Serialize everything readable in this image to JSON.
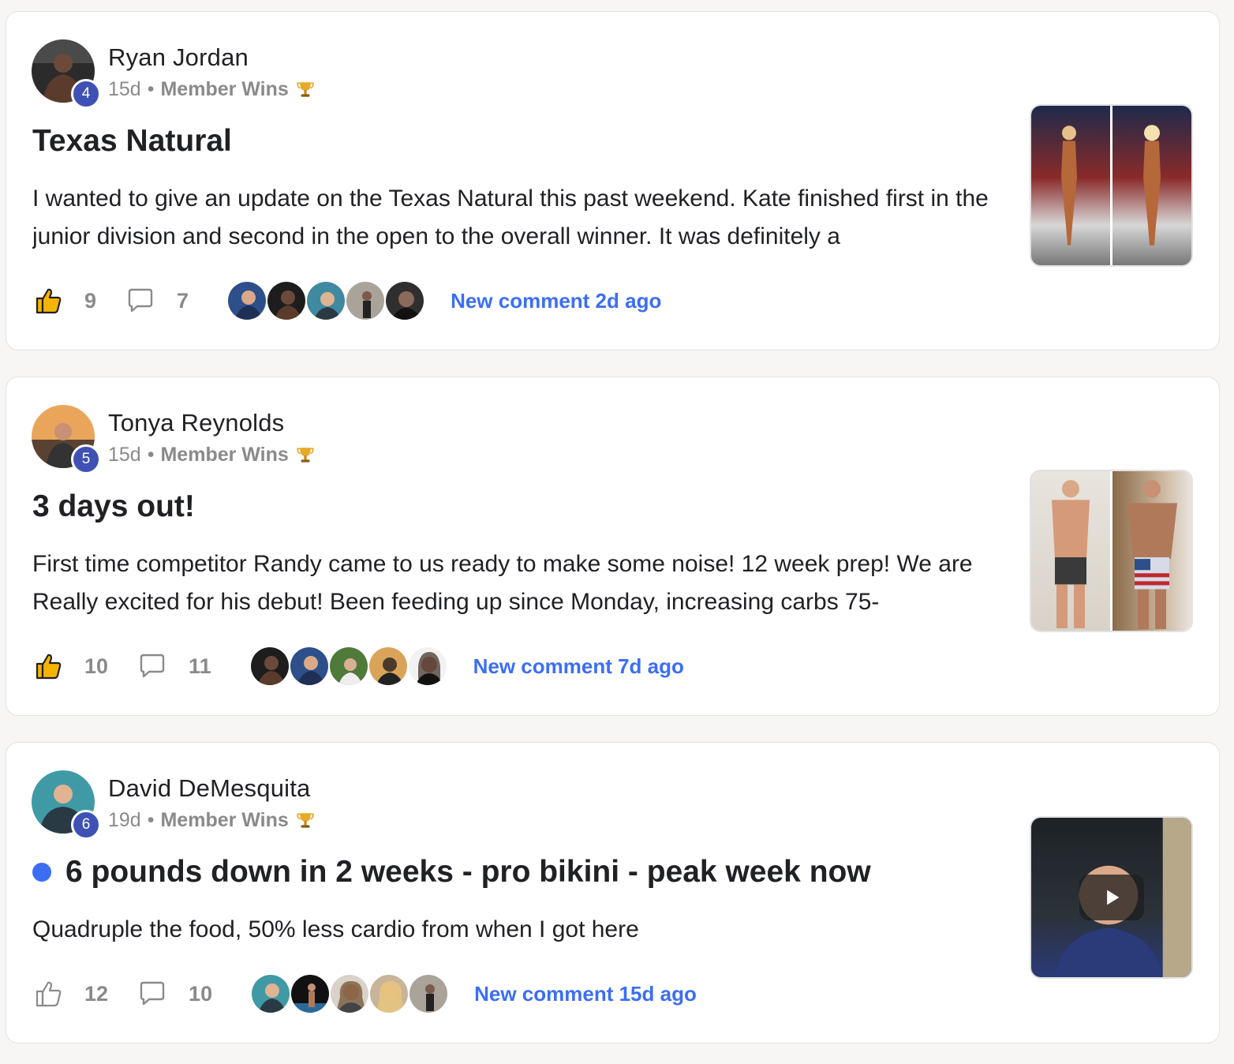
{
  "posts": [
    {
      "author": "Ryan Jordan",
      "level": "4",
      "age": "15d",
      "separator": "•",
      "category": "Member Wins",
      "title": "Texas Natural",
      "excerpt": "I wanted to give an update on the Texas Natural this past weekend. Kate finished first in the junior division and second in the open to the overall winner. It was definitely a",
      "likes": "9",
      "comments": "7",
      "new_comment": "New comment 2d ago",
      "liked": true,
      "unread": false,
      "thumbnail": "image"
    },
    {
      "author": "Tonya Reynolds",
      "level": "5",
      "age": "15d",
      "separator": "•",
      "category": "Member Wins",
      "title": "3 days out!",
      "excerpt": "First time competitor Randy came to us ready to make some noise! 12 week prep! We are Really excited for his debut! Been feeding up since Monday, increasing carbs 75-",
      "likes": "10",
      "comments": "11",
      "new_comment": "New comment 7d ago",
      "liked": true,
      "unread": false,
      "thumbnail": "image"
    },
    {
      "author": "David DeMesquita",
      "level": "6",
      "age": "19d",
      "separator": "•",
      "category": "Member Wins",
      "title": "6 pounds down in 2 weeks - pro bikini - peak week now",
      "excerpt": "Quadruple the food, 50% less cardio from when I got here",
      "likes": "12",
      "comments": "10",
      "new_comment": "New comment 15d ago",
      "liked": false,
      "unread": true,
      "thumbnail": "video"
    }
  ],
  "colors": {
    "accent": "#3b6ef5",
    "level_badge": "#3f51b5",
    "liked_icon": "#f5b400",
    "muted_text": "#8a8a8a"
  },
  "icons": {
    "like": "thumbs-up-icon",
    "comment": "comment-bubble-icon",
    "category": "trophy-icon",
    "video": "play-icon"
  }
}
